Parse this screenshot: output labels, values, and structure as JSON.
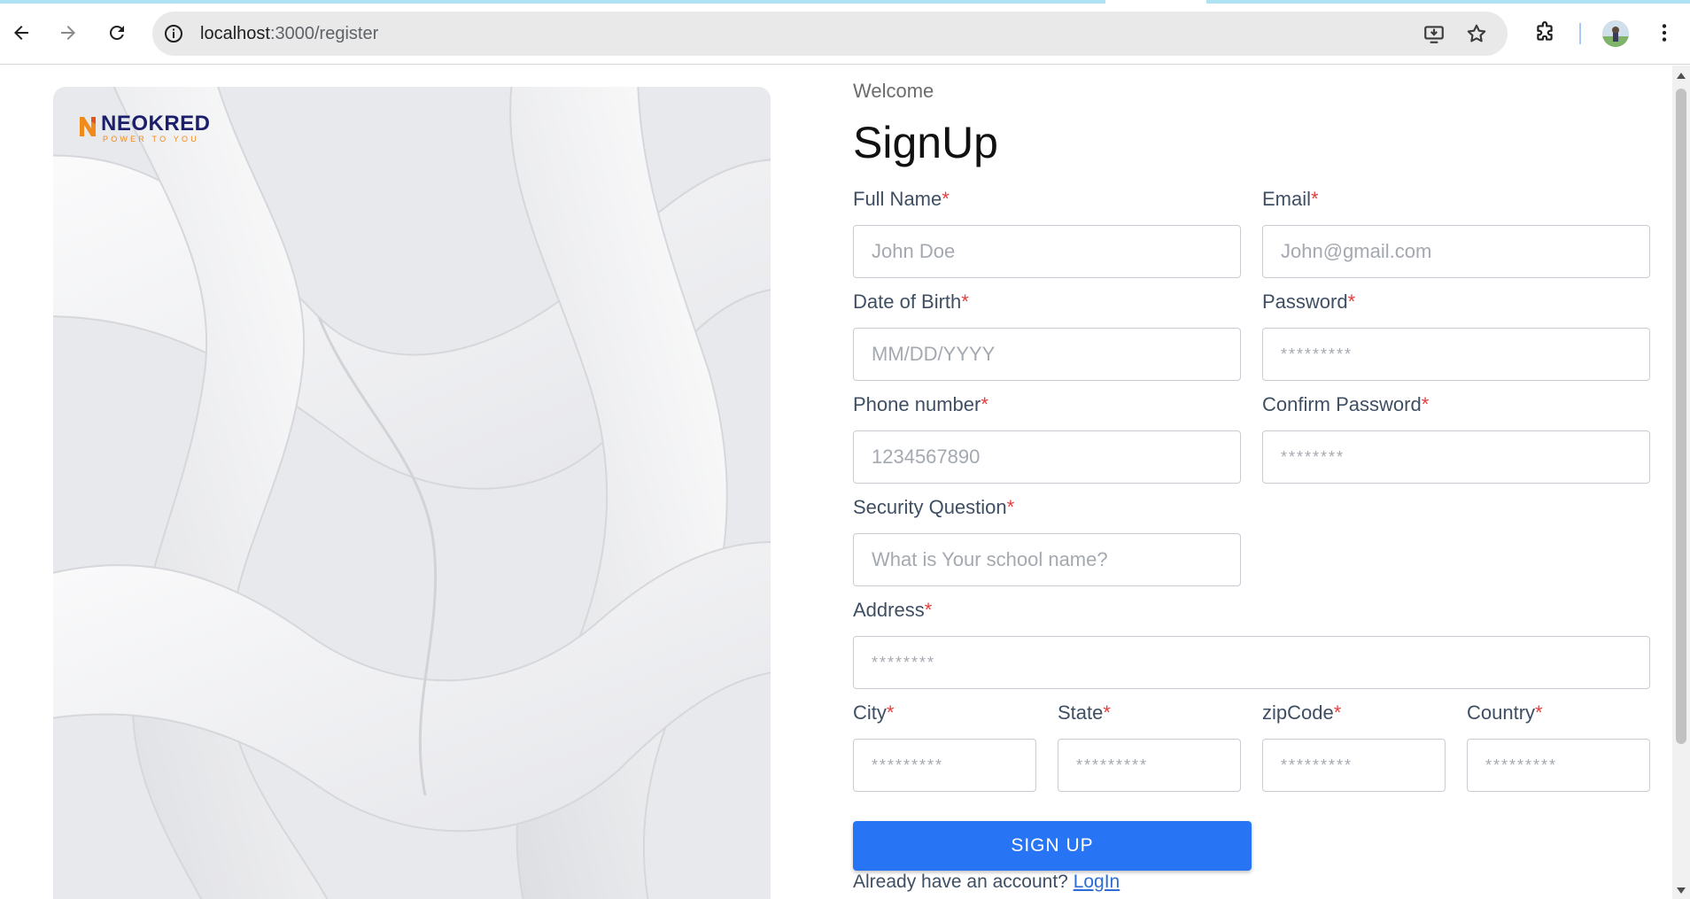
{
  "browser": {
    "url_host": "localhost",
    "url_path": ":3000/register",
    "icons": [
      "back-icon",
      "forward-icon",
      "reload-icon",
      "site-info-icon",
      "install-app-icon",
      "bookmark-star-icon",
      "extensions-icon",
      "profile-avatar",
      "menu-dots-icon"
    ]
  },
  "brand": {
    "name": "NEOKRED",
    "tagline": "POWER TO YOU",
    "mark_color": "#f08a1c",
    "name_color": "#1b1f6b"
  },
  "form": {
    "welcome": "Welcome",
    "title": "SignUp",
    "required_marker": "*",
    "fields": {
      "full_name": {
        "label": "Full Name",
        "placeholder": "John Doe"
      },
      "email": {
        "label": "Email",
        "placeholder": "John@gmail.com"
      },
      "dob": {
        "label": "Date of Birth",
        "placeholder": "MM/DD/YYYY"
      },
      "password": {
        "label": "Password",
        "placeholder": "*********"
      },
      "phone": {
        "label": "Phone number",
        "placeholder": "1234567890"
      },
      "confirm_password": {
        "label": "Confirm Password",
        "placeholder": "********"
      },
      "security_question": {
        "label": "Security Question",
        "placeholder": "What is Your school name?"
      },
      "address": {
        "label": "Address",
        "placeholder": "********"
      },
      "city": {
        "label": "City",
        "placeholder": "*********"
      },
      "state": {
        "label": "State",
        "placeholder": "*********"
      },
      "zip": {
        "label": "zipCode",
        "placeholder": "*********"
      },
      "country": {
        "label": "Country",
        "placeholder": "*********"
      }
    },
    "submit_label": "SIGN UP",
    "login_prompt": "Already have an account?",
    "login_link": "LogIn"
  },
  "colors": {
    "primary_button": "#2775f5",
    "required_asterisk": "#e53e3e",
    "link": "#2b6cd6",
    "label_text": "#3f4f63"
  }
}
